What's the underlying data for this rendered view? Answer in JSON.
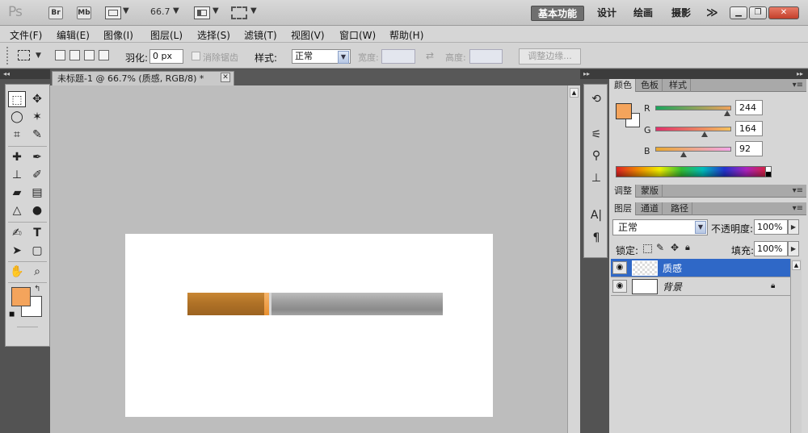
{
  "app": {
    "logo": "Ps",
    "bridge_label": "Br",
    "minibridge_label": "Mb",
    "zoom": "66.7",
    "workspaces": [
      "基本功能",
      "设计",
      "绘画",
      "摄影"
    ],
    "more": "≫"
  },
  "menubar": {
    "items": [
      "文件(F)",
      "编辑(E)",
      "图像(I)",
      "图层(L)",
      "选择(S)",
      "滤镜(T)",
      "视图(V)",
      "窗口(W)",
      "帮助(H)"
    ]
  },
  "options": {
    "feather_label": "羽化:",
    "feather_value": "0 px",
    "antialias_label": "消除锯齿",
    "style_label": "样式:",
    "style_value": "正常",
    "width_label": "宽度:",
    "height_label": "高度:",
    "refine_edge": "调整边缘..."
  },
  "document": {
    "tab_title": "未标题-1 @ 66.7% (质感, RGB/8) *",
    "close": "✕"
  },
  "color_panel": {
    "tabs": [
      "颜色",
      "色板",
      "样式"
    ],
    "fg_color": "#f4a45c",
    "r_label": "R",
    "g_label": "G",
    "b_label": "B",
    "r_value": "244",
    "g_value": "164",
    "b_value": "92"
  },
  "adjust_panel": {
    "tabs": [
      "调整",
      "蒙版"
    ]
  },
  "layers_panel": {
    "tabs": [
      "图层",
      "通道",
      "路径"
    ],
    "blend_mode": "正常",
    "opacity_label": "不透明度:",
    "opacity_value": "100%",
    "lock_label": "锁定:",
    "fill_label": "填充:",
    "fill_value": "100%",
    "layers": [
      {
        "name": "质感",
        "selected": true
      },
      {
        "name": "背景",
        "selected": false,
        "locked": true
      }
    ]
  }
}
